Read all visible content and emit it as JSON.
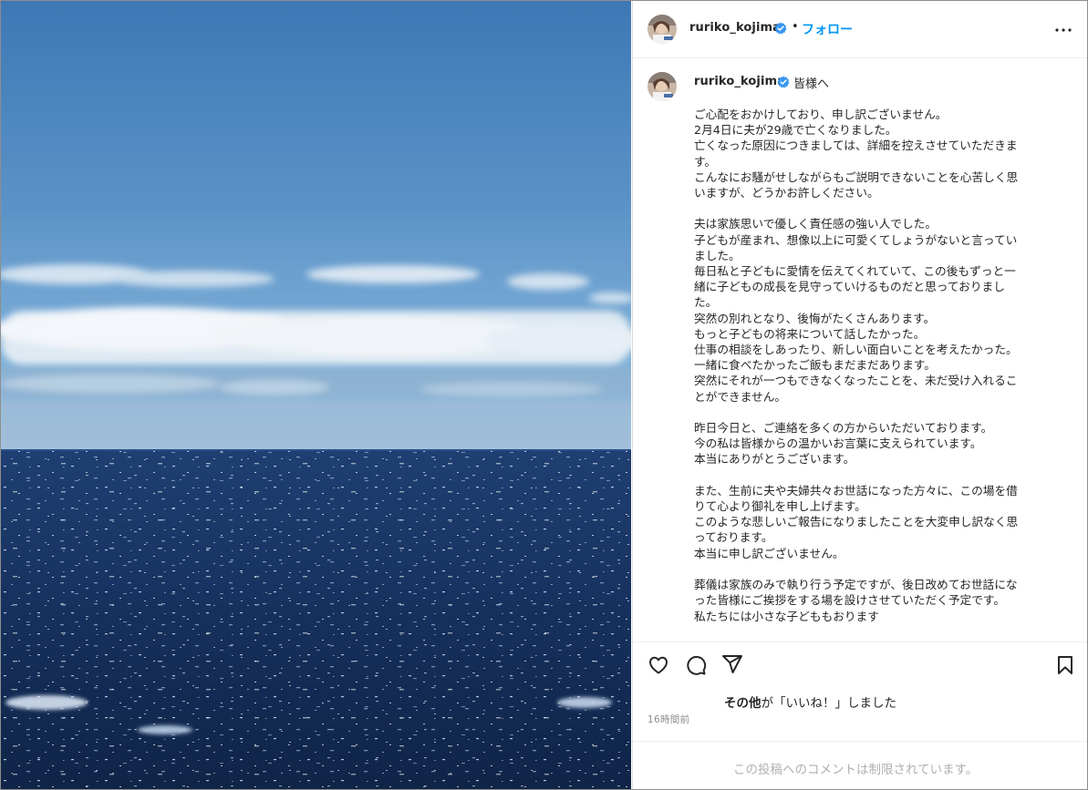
{
  "post": {
    "username": "ruriko_kojima",
    "follow_label": "フォロー",
    "dot": "•",
    "caption_greeting": "皆様へ",
    "caption_lines": [
      "ご心配をおかけしており、申し訳ございません。",
      "2月4日に夫が29歳で亡くなりました。",
      "亡くなった原因につきましては、詳細を控えさせていただきま",
      "す。",
      "こんなにお騒がせしながらもご説明できないことを心苦しく思",
      "いますが、どうかお許しください。",
      "",
      "夫は家族思いで優しく責任感の強い人でした。",
      "子どもが産まれ、想像以上に可愛くてしょうがないと言ってい",
      "ました。",
      "毎日私と子どもに愛情を伝えてくれていて、この後もずっと一",
      "緒に子どもの成長を見守っていけるものだと思っておりまし",
      "た。",
      "突然の別れとなり、後悔がたくさんあります。",
      "もっと子どもの将来について話したかった。",
      "仕事の相談をしあったり、新しい面白いことを考えたかった。",
      "一緒に食べたかったご飯もまだまだあります。",
      "突然にそれが一つもできなくなったことを、未だ受け入れるこ",
      "とができません。",
      "",
      "昨日今日と、ご連絡を多くの方からいただいております。",
      "今の私は皆様からの温かいお言葉に支えられています。",
      "本当にありがとうございます。",
      "",
      "また、生前に夫や夫婦共々お世話になった方々に、この場を借",
      "りて心より御礼を申し上げます。",
      "このような悲しいご報告になりましたことを大変申し訳なく思",
      "っております。",
      "本当に申し訳ございません。",
      "",
      "葬儀は家族のみで執り行う予定ですが、後日改めてお世話にな",
      "った皆様にご挨拶をする場を設けさせていただく予定です。",
      "私たちには小さな子どももおります"
    ],
    "likes_bold": "その他",
    "likes_rest": "が「いいね！」しました",
    "timestamp": "16時間前",
    "comments_disabled": "この投稿へのコメントは制限されています。"
  },
  "icons": {
    "verified": "verified-badge-icon",
    "more": "more-options-icon",
    "like": "heart-icon",
    "comment": "comment-bubble-icon",
    "share": "paper-plane-icon",
    "save": "bookmark-icon"
  },
  "colors": {
    "link": "#0095f6",
    "verified": "#3897f0",
    "muted": "#8e8e8e",
    "disabled_text": "#b0b0b0"
  }
}
